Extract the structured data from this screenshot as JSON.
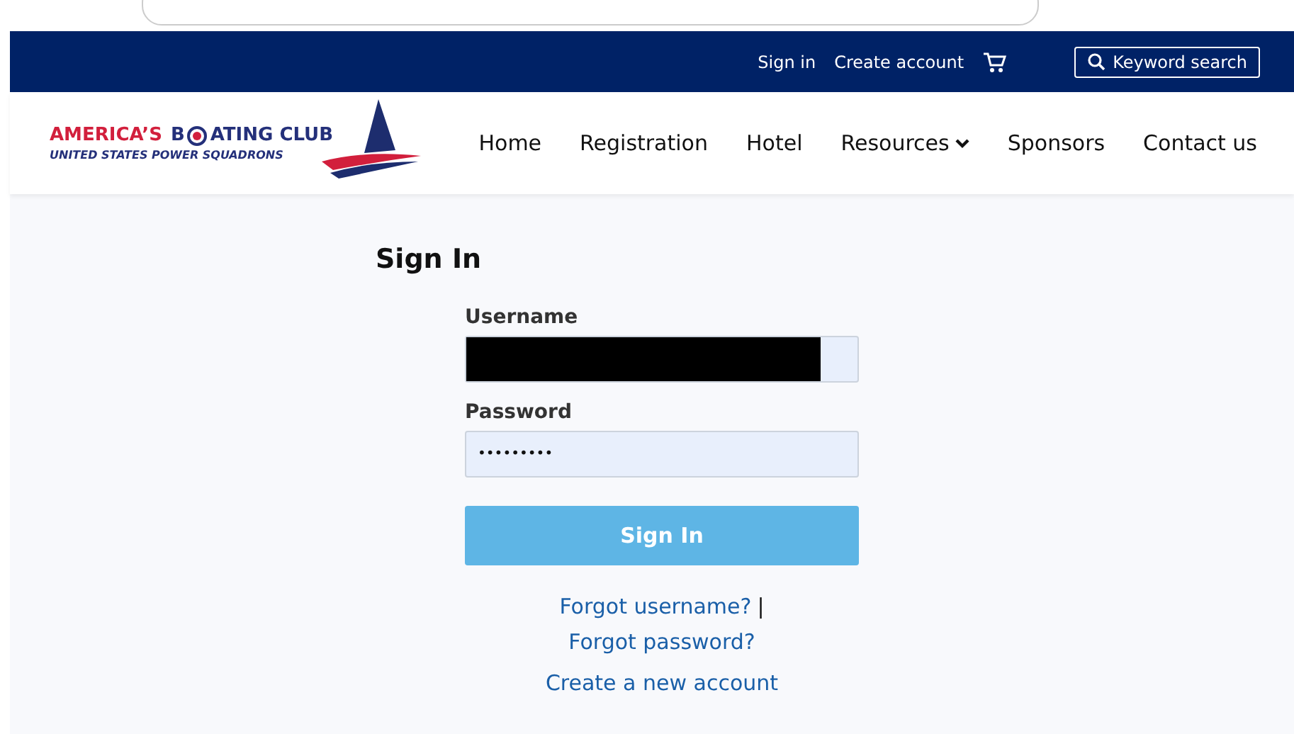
{
  "top_bar": {
    "links": [
      "Sign in",
      "Create account"
    ],
    "search": {
      "label": "Keyword search"
    }
  },
  "logo": {
    "title_start": "AMERICA’S",
    "title_b": "B",
    "title_end": "ATING CLUB",
    "subtitle": "UNITED STATES POWER SQUADRONS"
  },
  "nav": [
    {
      "label": "Home",
      "has_dropdown": false
    },
    {
      "label": "Registration",
      "has_dropdown": false
    },
    {
      "label": "Hotel",
      "has_dropdown": false
    },
    {
      "label": "Resources",
      "has_dropdown": true
    },
    {
      "label": "Sponsors",
      "has_dropdown": false
    },
    {
      "label": "Contact us",
      "has_dropdown": false
    }
  ],
  "form": {
    "title": "Sign In",
    "fields": [
      {
        "label": "Username",
        "redacted": true
      },
      {
        "label": "Password",
        "value": "•••••••••",
        "redacted": false
      }
    ],
    "submit": "Sign In",
    "links": [
      {
        "text": "Forgot username?",
        "separator": "|"
      },
      {
        "text": "Forgot password?"
      },
      {
        "text": "Create a new account"
      }
    ]
  }
}
